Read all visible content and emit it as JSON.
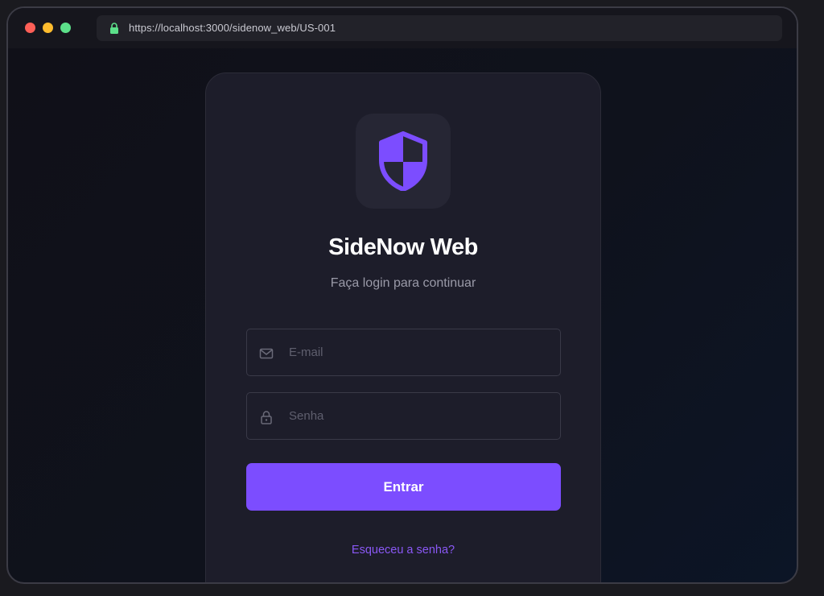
{
  "browser": {
    "url": "https://localhost:3000/sidenow_web/US-001"
  },
  "login": {
    "app_title": "SideNow Web",
    "subtitle": "Faça login para continuar",
    "email_placeholder": "E-mail",
    "password_placeholder": "Senha",
    "submit_label": "Entrar",
    "forgot_password": "Esqueceu a senha?"
  },
  "icons": {
    "logo": "shield-icon",
    "email": "mail-icon",
    "password": "lock-icon",
    "url": "lock-icon"
  },
  "colors": {
    "accent": "#7c4dff",
    "link": "#8a58f5",
    "background": "#101018",
    "card": "#1d1d2a",
    "secure": "#5ce08a"
  }
}
